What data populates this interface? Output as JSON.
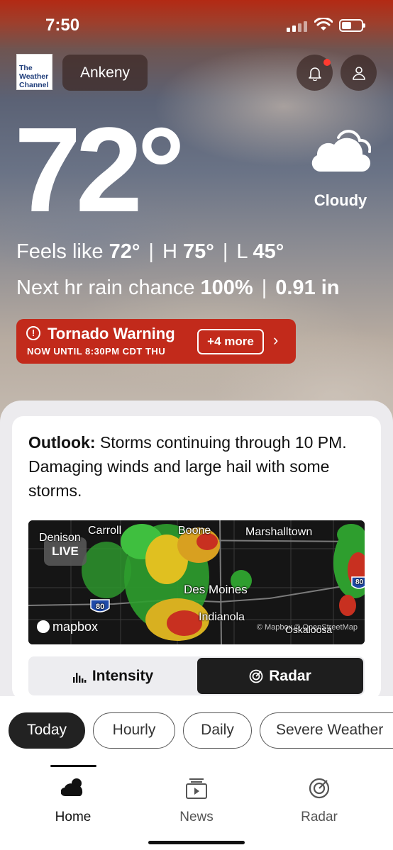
{
  "status": {
    "time": "7:50"
  },
  "header": {
    "logo_lines": [
      "The",
      "Weather",
      "Channel"
    ],
    "location": "Ankeny",
    "notification_icon": "bell-icon",
    "profile_icon": "person-icon"
  },
  "current": {
    "temperature": "72°",
    "condition": "Cloudy",
    "condition_icon": "cloud-icon",
    "feels_like_label": "Feels like",
    "feels_like": "72°",
    "high_label": "H",
    "high": "75°",
    "low_label": "L",
    "low": "45°",
    "rain_label": "Next hr rain chance",
    "rain_chance": "100%",
    "rain_amount": "0.91 in",
    "separator": "|"
  },
  "alert": {
    "title": "Tornado Warning",
    "subtitle": "NOW UNTIL 8:30PM CDT THU",
    "more": "+4 more",
    "chevron": "›",
    "icon": "!",
    "color": "#c22a1b"
  },
  "outlook": {
    "label": "Outlook:",
    "text": "Storms continuing through 10 PM. Damaging winds and large hail with some storms."
  },
  "map": {
    "live": "LIVE",
    "cities": {
      "denison": "Denison",
      "carroll": "Carroll",
      "boone": "Boone",
      "marshalltown": "Marshalltown",
      "des_moines": "Des Moines",
      "indianola": "Indianola",
      "oskaloosa": "Oskaloosa"
    },
    "highway": "80",
    "highway_right": "80",
    "provider": "mapbox",
    "attribution": "© Mapbox © OpenStreetMap"
  },
  "map_toggle": {
    "intensity": "Intensity",
    "radar": "Radar",
    "selected": "Radar"
  },
  "tabs": [
    "Today",
    "Hourly",
    "Daily",
    "Severe Weather"
  ],
  "active_tab": "Today",
  "bottom_nav": {
    "home": "Home",
    "news": "News",
    "radar": "Radar",
    "active": "Home"
  }
}
